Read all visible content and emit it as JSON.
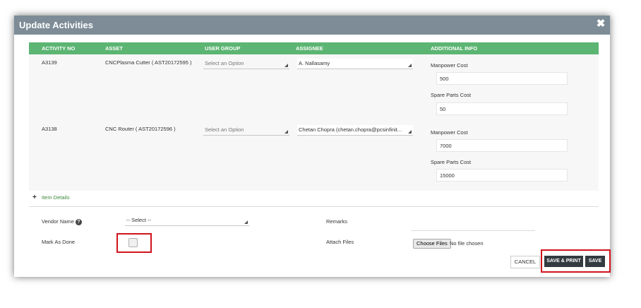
{
  "dialog": {
    "title": "Update Activities",
    "close_icon": "close-icon"
  },
  "table": {
    "headers": [
      "ACTIVITY NO",
      "ASSET",
      "USER GROUP",
      "ASSIGNEE",
      "ADDITIONAL INFO"
    ],
    "rows": [
      {
        "activity_no": "A3139",
        "asset": "CNCPlasma Cutter ( AST20172595 )",
        "user_group": "Select an Option",
        "assignee": "A. Nallasamy",
        "manpower_label": "Manpower Cost",
        "manpower_value": "500",
        "spare_label": "Spare Parts Cost",
        "spare_value": "50"
      },
      {
        "activity_no": "A3138",
        "asset": "CNC Router ( AST20172596 )",
        "user_group": "Select an Option",
        "assignee": "Chetan Chopra (chetan.chopra@pcsinfinit...",
        "manpower_label": "Manpower Cost",
        "manpower_value": "7000",
        "spare_label": "Spare Parts Cost",
        "spare_value": "15000"
      }
    ]
  },
  "item_details": {
    "plus": "+",
    "label": "Item Details"
  },
  "form": {
    "vendor_label": "Vendor Name",
    "vendor_help_icon": "?",
    "vendor_value": "-- Select --",
    "mark_done_label": "Mark As Done",
    "remarks_label": "Remarks",
    "attach_label": "Attach Files",
    "choose_files": "Choose Files",
    "no_file": "No file chosen"
  },
  "buttons": {
    "cancel": "CANCEL",
    "save_print": "SAVE & PRINT",
    "save": "SAVE"
  },
  "colors": {
    "titlebar": "#7d8c96",
    "header": "#5cb572",
    "highlight": "#d0141c",
    "dark_button": "#333b40"
  }
}
